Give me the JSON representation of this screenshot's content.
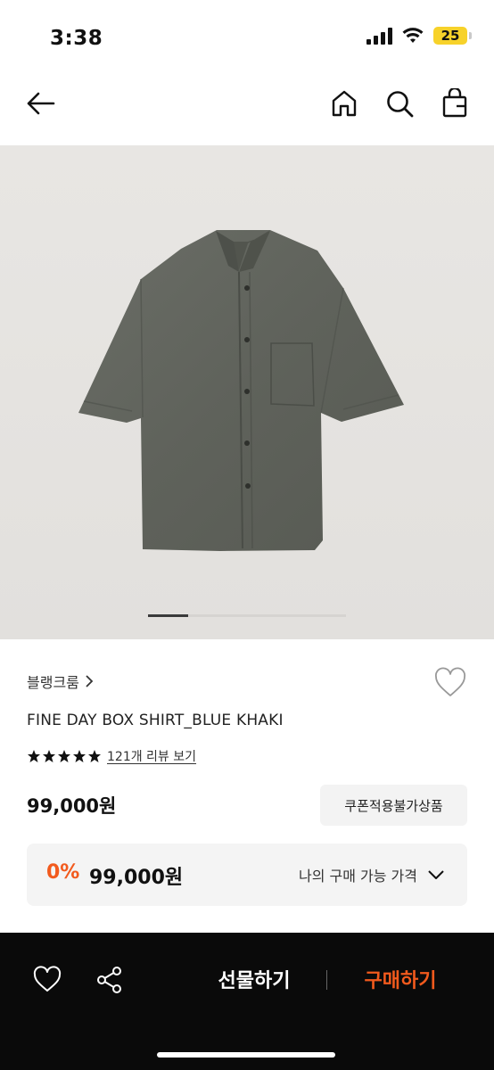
{
  "status_bar": {
    "time": "3:38",
    "battery": "25"
  },
  "product": {
    "brand": "블랭크룸",
    "name": "FINE DAY BOX SHIRT_BLUE KHAKI",
    "rating_stars": 5,
    "review_text": "121개 리뷰 보기",
    "price": "99,000원",
    "coupon_note": "쿠폰적용불가상품",
    "discount_percent": "0%",
    "my_price": "99,000원",
    "my_price_label": "나의 구매 가능 가격",
    "image_index": 1
  },
  "bottom_bar": {
    "gift_label": "선물하기",
    "buy_label": "구매하기"
  },
  "icons": {
    "back": "arrow-left-icon",
    "home": "home-icon",
    "search": "search-icon",
    "bag": "shopping-bag-icon",
    "wish": "heart-icon",
    "share": "share-icon",
    "expand": "chevron-down-icon"
  },
  "colors": {
    "accent": "#f25a1d",
    "bottom_bar": "#0a0a0a",
    "star": "#111111"
  }
}
